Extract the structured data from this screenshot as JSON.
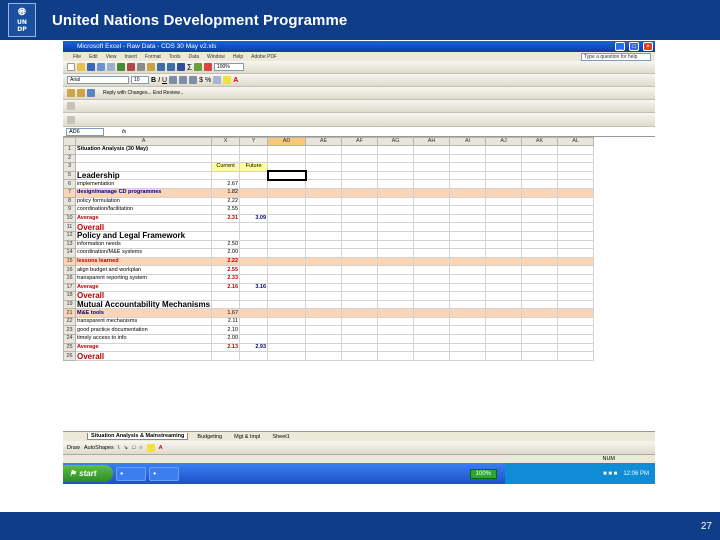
{
  "header": {
    "org": "United Nations Development Programme",
    "logo_top": "UN",
    "logo_bottom": "DP"
  },
  "excel": {
    "title": "Microsoft Excel - Raw Data - CDS 30 May v2.xls",
    "menu": [
      "File",
      "Edit",
      "View",
      "Insert",
      "Format",
      "Tools",
      "Data",
      "Window",
      "Help",
      "Adobe PDF"
    ],
    "help_placeholder": "Type a question for help",
    "font": "Arial",
    "font_size": "10",
    "zoom": "100%",
    "reply_text": "Reply with Changes...  End Review...",
    "name_box": "AD6",
    "columns": [
      "A",
      "X",
      "Y",
      "AD",
      "AE",
      "AF",
      "AG",
      "AH",
      "AI",
      "AJ",
      "AK",
      "AL"
    ],
    "rows": [
      {
        "n": "1",
        "label": "Situation Analysis (30 May)",
        "x": "",
        "y": "",
        "style": "bold"
      },
      {
        "n": "2",
        "label": "",
        "x": "",
        "y": ""
      },
      {
        "n": "3",
        "label": "",
        "x": "Current",
        "y": "Future"
      },
      {
        "n": "5",
        "label": "Leadership",
        "x": "",
        "y": "",
        "style": "sec"
      },
      {
        "n": "6",
        "label": "implementation",
        "x": "2.67",
        "y": ""
      },
      {
        "n": "7",
        "label": "design/manage CD programmes",
        "x": "1.82",
        "y": "",
        "style": "orange-blue"
      },
      {
        "n": "8",
        "label": "policy formulation",
        "x": "2.22",
        "y": ""
      },
      {
        "n": "9",
        "label": "coordination/facilitation",
        "x": "2.55",
        "y": ""
      },
      {
        "n": "10",
        "label": "Average",
        "x": "2.31",
        "y": "3.09",
        "style": "avg"
      },
      {
        "n": "11",
        "label": "Overall",
        "x": "",
        "y": "",
        "style": "overall"
      },
      {
        "n": "12",
        "label": "Policy and Legal Framework",
        "x": "",
        "y": "",
        "style": "sec"
      },
      {
        "n": "13",
        "label": "information needs",
        "x": "2.50",
        "y": ""
      },
      {
        "n": "14",
        "label": "coordination/M&E systems",
        "x": "2.00",
        "y": ""
      },
      {
        "n": "15",
        "label": "lessons learned",
        "x": "2.22",
        "y": "",
        "style": "orange-red"
      },
      {
        "n": "16",
        "label": "align budget and workplan",
        "x": "2.55",
        "y": "",
        "style": "redval"
      },
      {
        "n": "16",
        "label": "transparent reporting system",
        "x": "2.33",
        "y": "",
        "style": "redval"
      },
      {
        "n": "17",
        "label": "Average",
        "x": "2.16",
        "y": "3.16",
        "style": "avg"
      },
      {
        "n": "18",
        "label": "Overall",
        "x": "",
        "y": "",
        "style": "overall"
      },
      {
        "n": "19",
        "label": "Mutual Accountability Mechanisms",
        "x": "",
        "y": "",
        "style": "sec"
      },
      {
        "n": "21",
        "label": "M&E tools",
        "x": "1.67",
        "y": "",
        "style": "orange-blue"
      },
      {
        "n": "22",
        "label": "transparent mechanisms",
        "x": "2.11",
        "y": ""
      },
      {
        "n": "23",
        "label": "good practice documentation",
        "x": "2.10",
        "y": ""
      },
      {
        "n": "24",
        "label": "timely access to info",
        "x": "2.00",
        "y": ""
      },
      {
        "n": "25",
        "label": "Average",
        "x": "2.13",
        "y": "2.93",
        "style": "avg"
      },
      {
        "n": "26",
        "label": "Overall",
        "x": "",
        "y": "",
        "style": "overall"
      }
    ],
    "sheet_tabs": [
      "Situation Analysis & Mainstreaming",
      "Budgeting",
      "Mgt & Impl",
      "Sheet1"
    ],
    "draw_label": "Draw",
    "autoshapes_label": "AutoShapes",
    "status_right": "NUM",
    "taskbar": {
      "start": "start",
      "zoom": "100%",
      "clock": "12:06 PM"
    }
  },
  "footer": {
    "page": "27"
  }
}
